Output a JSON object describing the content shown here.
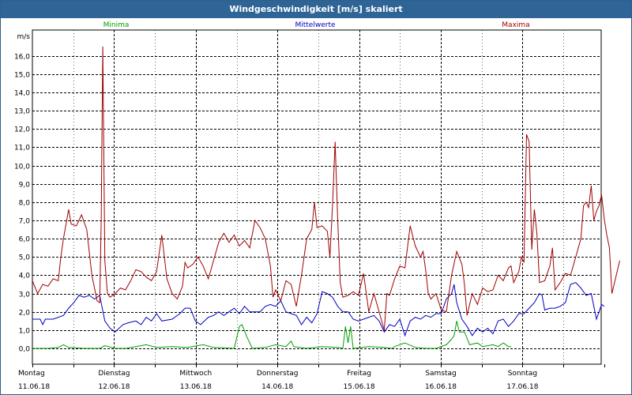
{
  "window": {
    "title": "Windgeschwindigkeit [m/s] skaliert"
  },
  "chart_data": {
    "type": "line",
    "title": "Windgeschwindigkeit [m/s] skaliert",
    "ylabel": "m/s",
    "xlabel": "",
    "ylim": [
      -0.4,
      17.0
    ],
    "yticks": [
      "0,0",
      "1,0",
      "2,0",
      "3,0",
      "4,0",
      "5,0",
      "6,0",
      "7,0",
      "8,0",
      "9,0",
      "10,0",
      "11,0",
      "12,0",
      "13,0",
      "14,0",
      "15,0",
      "16,0"
    ],
    "xlim": [
      0,
      7
    ],
    "day_labels": [
      {
        "day": "Montag",
        "date": "11.06.18"
      },
      {
        "day": "Dienstag",
        "date": "12.06.18"
      },
      {
        "day": "Mittwoch",
        "date": "13.06.18"
      },
      {
        "day": "Donnerstag",
        "date": "14.06.18"
      },
      {
        "day": "Freitag",
        "date": "15.06.18"
      },
      {
        "day": "Samstag",
        "date": "16.06.18"
      },
      {
        "day": "Sonntag",
        "date": "17.06.18"
      }
    ],
    "grid": true,
    "x_unit": "days since Montag 11.06.18 00:00",
    "series": [
      {
        "name": "Minima",
        "color": "#00a000",
        "points": [
          [
            0,
            0.0
          ],
          [
            0.3,
            0.0
          ],
          [
            0.5,
            0.05
          ],
          [
            0.6,
            0.2
          ],
          [
            0.7,
            0.05
          ],
          [
            1.0,
            0.0
          ],
          [
            1.3,
            0.0
          ],
          [
            1.4,
            0.15
          ],
          [
            1.6,
            0.0
          ],
          [
            1.8,
            0.0
          ],
          [
            2.0,
            0.1
          ],
          [
            2.2,
            0.2
          ],
          [
            2.4,
            0.05
          ],
          [
            2.7,
            0.1
          ],
          [
            3.0,
            0.05
          ],
          [
            3.3,
            0.2
          ],
          [
            3.5,
            0.05
          ],
          [
            3.9,
            0.0
          ],
          [
            3.95,
            0.6
          ],
          [
            4.0,
            1.2
          ],
          [
            4.05,
            1.3
          ],
          [
            4.15,
            0.6
          ],
          [
            4.25,
            0.0
          ],
          [
            4.5,
            0.05
          ],
          [
            4.7,
            0.2
          ],
          [
            4.9,
            0.1
          ],
          [
            5.0,
            0.4
          ],
          [
            5.05,
            0.1
          ],
          [
            5.3,
            0.0
          ],
          [
            5.6,
            0.1
          ],
          [
            5.9,
            0.05
          ],
          [
            6.0,
            0.0
          ],
          [
            6.05,
            1.2
          ],
          [
            6.1,
            0.3
          ],
          [
            6.15,
            1.2
          ],
          [
            6.2,
            0.0
          ],
          [
            6.5,
            0.1
          ],
          [
            6.8,
            0.05
          ],
          [
            6.95,
            0.0
          ],
          [
            7.0,
            0.1
          ],
          [
            7.2,
            0.3
          ],
          [
            7.4,
            0.05
          ],
          [
            7.6,
            0.0
          ],
          [
            7.8,
            0.0
          ],
          [
            8.0,
            0.2
          ],
          [
            8.1,
            0.5
          ],
          [
            8.15,
            0.7
          ],
          [
            8.2,
            1.5
          ],
          [
            8.25,
            0.9
          ],
          [
            8.35,
            0.9
          ],
          [
            8.45,
            0.2
          ],
          [
            8.6,
            0.3
          ],
          [
            8.7,
            0.1
          ],
          [
            8.9,
            0.2
          ],
          [
            9.0,
            0.1
          ],
          [
            9.1,
            0.3
          ],
          [
            9.2,
            0.1
          ],
          [
            9.25,
            0.1
          ]
        ]
      },
      {
        "name": "Mittelwerte",
        "color": "#0000c0",
        "points": [
          [
            0,
            1.6
          ],
          [
            0.15,
            1.6
          ],
          [
            0.2,
            1.3
          ],
          [
            0.25,
            1.6
          ],
          [
            0.4,
            1.6
          ],
          [
            0.6,
            1.8
          ],
          [
            0.7,
            2.2
          ],
          [
            0.8,
            2.5
          ],
          [
            0.9,
            2.9
          ],
          [
            1.0,
            2.8
          ],
          [
            1.1,
            2.9
          ],
          [
            1.2,
            2.7
          ],
          [
            1.3,
            2.9
          ],
          [
            1.4,
            1.5
          ],
          [
            1.5,
            1.1
          ],
          [
            1.6,
            0.9
          ],
          [
            1.75,
            1.3
          ],
          [
            1.85,
            1.4
          ],
          [
            2.0,
            1.5
          ],
          [
            2.1,
            1.3
          ],
          [
            2.2,
            1.7
          ],
          [
            2.3,
            1.5
          ],
          [
            2.4,
            1.9
          ],
          [
            2.5,
            1.5
          ],
          [
            2.7,
            1.6
          ],
          [
            2.85,
            1.9
          ],
          [
            2.95,
            2.2
          ],
          [
            3.05,
            2.2
          ],
          [
            3.15,
            1.5
          ],
          [
            3.25,
            1.3
          ],
          [
            3.4,
            1.7
          ],
          [
            3.5,
            1.8
          ],
          [
            3.6,
            2.0
          ],
          [
            3.7,
            1.8
          ],
          [
            3.8,
            2.0
          ],
          [
            3.9,
            2.2
          ],
          [
            4.0,
            1.9
          ],
          [
            4.1,
            2.3
          ],
          [
            4.2,
            2.0
          ],
          [
            4.3,
            2.0
          ],
          [
            4.4,
            2.0
          ],
          [
            4.5,
            2.3
          ],
          [
            4.6,
            2.4
          ],
          [
            4.7,
            2.3
          ],
          [
            4.8,
            2.6
          ],
          [
            4.9,
            2.0
          ],
          [
            5.0,
            1.9
          ],
          [
            5.1,
            1.8
          ],
          [
            5.2,
            1.3
          ],
          [
            5.3,
            1.7
          ],
          [
            5.4,
            1.4
          ],
          [
            5.5,
            1.9
          ],
          [
            5.6,
            3.1
          ],
          [
            5.7,
            3.0
          ],
          [
            5.8,
            2.8
          ],
          [
            5.9,
            2.3
          ],
          [
            6.0,
            2.0
          ],
          [
            6.1,
            2.0
          ],
          [
            6.2,
            1.6
          ],
          [
            6.3,
            1.5
          ],
          [
            6.4,
            1.6
          ],
          [
            6.5,
            1.7
          ],
          [
            6.6,
            1.8
          ],
          [
            6.7,
            1.5
          ],
          [
            6.8,
            0.9
          ],
          [
            6.9,
            1.3
          ],
          [
            7.0,
            1.2
          ],
          [
            7.1,
            1.6
          ],
          [
            7.2,
            0.7
          ],
          [
            7.3,
            1.5
          ],
          [
            7.4,
            1.7
          ],
          [
            7.5,
            1.6
          ],
          [
            7.6,
            1.8
          ],
          [
            7.7,
            1.7
          ],
          [
            7.8,
            1.9
          ],
          [
            7.9,
            1.9
          ],
          [
            8.0,
            2.7
          ],
          [
            8.1,
            3.0
          ],
          [
            8.15,
            3.5
          ],
          [
            8.2,
            2.5
          ],
          [
            8.3,
            1.6
          ],
          [
            8.4,
            1.2
          ],
          [
            8.5,
            0.7
          ],
          [
            8.6,
            1.1
          ],
          [
            8.7,
            0.9
          ],
          [
            8.8,
            1.1
          ],
          [
            8.9,
            0.8
          ],
          [
            9.0,
            1.5
          ],
          [
            9.1,
            1.6
          ],
          [
            9.2,
            1.2
          ],
          [
            9.3,
            1.5
          ],
          [
            9.4,
            1.9
          ],
          [
            9.5,
            1.9
          ],
          [
            9.6,
            2.2
          ],
          [
            9.7,
            2.5
          ],
          [
            9.8,
            3.0
          ],
          [
            9.85,
            2.9
          ],
          [
            9.9,
            2.1
          ],
          [
            10.0,
            2.2
          ],
          [
            10.1,
            2.2
          ],
          [
            10.2,
            2.3
          ],
          [
            10.3,
            2.5
          ],
          [
            10.4,
            3.5
          ],
          [
            10.5,
            3.6
          ],
          [
            10.6,
            3.3
          ],
          [
            10.7,
            2.9
          ],
          [
            10.8,
            3.0
          ],
          [
            10.9,
            1.6
          ],
          [
            11.0,
            2.4
          ],
          [
            11.05,
            2.3
          ]
        ]
      },
      {
        "name": "Maxima",
        "color": "#a00000",
        "points": [
          [
            0,
            3.7
          ],
          [
            0.1,
            3.0
          ],
          [
            0.2,
            3.5
          ],
          [
            0.3,
            3.4
          ],
          [
            0.4,
            3.8
          ],
          [
            0.5,
            3.7
          ],
          [
            0.55,
            5.0
          ],
          [
            0.6,
            6.0
          ],
          [
            0.7,
            7.6
          ],
          [
            0.75,
            6.8
          ],
          [
            0.85,
            6.7
          ],
          [
            0.95,
            7.3
          ],
          [
            1.05,
            6.5
          ],
          [
            1.15,
            4.0
          ],
          [
            1.25,
            2.6
          ],
          [
            1.3,
            2.5
          ],
          [
            1.33,
            7.0
          ],
          [
            1.36,
            16.5
          ],
          [
            1.4,
            4.8
          ],
          [
            1.45,
            3.0
          ],
          [
            1.5,
            2.8
          ],
          [
            1.6,
            3.0
          ],
          [
            1.7,
            3.3
          ],
          [
            1.8,
            3.2
          ],
          [
            1.9,
            3.7
          ],
          [
            2.0,
            4.3
          ],
          [
            2.1,
            4.2
          ],
          [
            2.2,
            3.9
          ],
          [
            2.3,
            3.7
          ],
          [
            2.4,
            4.2
          ],
          [
            2.5,
            6.2
          ],
          [
            2.6,
            3.8
          ],
          [
            2.7,
            3.0
          ],
          [
            2.8,
            2.7
          ],
          [
            2.9,
            3.4
          ],
          [
            2.95,
            4.7
          ],
          [
            3.0,
            4.4
          ],
          [
            3.1,
            4.6
          ],
          [
            3.2,
            5.0
          ],
          [
            3.3,
            4.5
          ],
          [
            3.4,
            3.8
          ],
          [
            3.5,
            4.8
          ],
          [
            3.6,
            5.8
          ],
          [
            3.7,
            6.3
          ],
          [
            3.8,
            5.8
          ],
          [
            3.9,
            6.2
          ],
          [
            4.0,
            5.6
          ],
          [
            4.1,
            5.9
          ],
          [
            4.2,
            5.5
          ],
          [
            4.3,
            7.0
          ],
          [
            4.4,
            6.6
          ],
          [
            4.5,
            6.0
          ],
          [
            4.6,
            4.5
          ],
          [
            4.65,
            2.8
          ],
          [
            4.7,
            3.2
          ],
          [
            4.8,
            2.6
          ],
          [
            4.9,
            3.7
          ],
          [
            5.0,
            3.5
          ],
          [
            5.1,
            2.3
          ],
          [
            5.2,
            4.0
          ],
          [
            5.3,
            6.0
          ],
          [
            5.4,
            6.5
          ],
          [
            5.45,
            8.0
          ],
          [
            5.5,
            6.6
          ],
          [
            5.6,
            6.7
          ],
          [
            5.7,
            6.4
          ],
          [
            5.75,
            5.0
          ],
          [
            5.8,
            7.8
          ],
          [
            5.85,
            11.3
          ],
          [
            5.9,
            7.0
          ],
          [
            5.95,
            3.6
          ],
          [
            6.0,
            2.8
          ],
          [
            6.1,
            2.9
          ],
          [
            6.2,
            3.1
          ],
          [
            6.3,
            2.9
          ],
          [
            6.4,
            4.1
          ],
          [
            6.5,
            2.0
          ],
          [
            6.6,
            3.0
          ],
          [
            6.7,
            2.0
          ],
          [
            6.75,
            1.5
          ],
          [
            6.8,
            1.0
          ],
          [
            6.85,
            3.0
          ],
          [
            6.9,
            2.9
          ],
          [
            7.0,
            3.8
          ],
          [
            7.1,
            4.5
          ],
          [
            7.2,
            4.4
          ],
          [
            7.3,
            6.7
          ],
          [
            7.4,
            5.6
          ],
          [
            7.5,
            5.0
          ],
          [
            7.55,
            5.3
          ],
          [
            7.6,
            4.3
          ],
          [
            7.65,
            3.0
          ],
          [
            7.7,
            2.7
          ],
          [
            7.8,
            3.0
          ],
          [
            7.9,
            2.1
          ],
          [
            8.0,
            2.0
          ],
          [
            8.1,
            4.0
          ],
          [
            8.2,
            5.3
          ],
          [
            8.3,
            4.6
          ],
          [
            8.35,
            3.5
          ],
          [
            8.4,
            1.8
          ],
          [
            8.5,
            3.0
          ],
          [
            8.6,
            2.4
          ],
          [
            8.7,
            3.3
          ],
          [
            8.8,
            3.1
          ],
          [
            8.9,
            3.2
          ],
          [
            9.0,
            4.0
          ],
          [
            9.1,
            3.7
          ],
          [
            9.2,
            4.4
          ],
          [
            9.25,
            4.5
          ],
          [
            9.3,
            3.6
          ],
          [
            9.4,
            4.2
          ],
          [
            9.45,
            5.0
          ],
          [
            9.5,
            4.7
          ],
          [
            9.55,
            11.7
          ],
          [
            9.6,
            11.3
          ],
          [
            9.65,
            5.4
          ],
          [
            9.7,
            7.6
          ],
          [
            9.75,
            6.3
          ],
          [
            9.8,
            3.6
          ],
          [
            9.9,
            3.7
          ],
          [
            10.0,
            4.5
          ],
          [
            10.05,
            5.5
          ],
          [
            10.1,
            3.2
          ],
          [
            10.2,
            3.6
          ],
          [
            10.3,
            4.1
          ],
          [
            10.4,
            4.0
          ],
          [
            10.5,
            5.0
          ],
          [
            10.6,
            6.0
          ],
          [
            10.65,
            7.8
          ],
          [
            10.7,
            8.0
          ],
          [
            10.75,
            7.7
          ],
          [
            10.8,
            8.9
          ],
          [
            10.85,
            7.0
          ],
          [
            10.9,
            7.5
          ],
          [
            10.95,
            7.8
          ],
          [
            11.0,
            8.4
          ],
          [
            11.05,
            7.1
          ],
          [
            11.1,
            6.2
          ],
          [
            11.15,
            5.5
          ],
          [
            11.2,
            3.0
          ],
          [
            11.3,
            4.2
          ],
          [
            11.35,
            4.8
          ]
        ]
      }
    ]
  }
}
